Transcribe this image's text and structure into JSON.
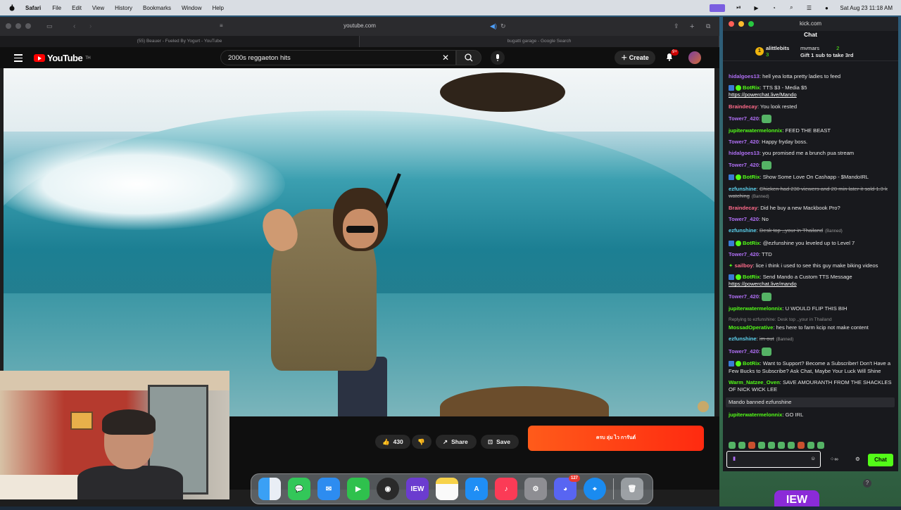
{
  "menubar": {
    "app": "Safari",
    "items": [
      "File",
      "Edit",
      "View",
      "History",
      "Bookmarks",
      "Window",
      "Help"
    ],
    "clock": "Sat Aug 23  11:18 AM"
  },
  "safari": {
    "address": "youtube.com",
    "tabs": [
      "(55) Beauer - Fueled By Yogurt - YouTube",
      "bugatti garage - Google Search"
    ]
  },
  "youtube": {
    "logo": "YouTube",
    "logo_sup": "TH",
    "search_value": "2000s reggaeton hits",
    "create_label": "Create",
    "notif_badge": "9+",
    "likes": "430",
    "share_label": "Share",
    "save_label": "Save",
    "ad_text": "ครบ ลุ่ม ไว การันต์"
  },
  "dock": {
    "icons": [
      "finder",
      "messages",
      "mail",
      "facetime",
      "obs",
      "iew",
      "notes",
      "app-store",
      "music",
      "system-settings",
      "discord",
      "safari",
      "trash"
    ],
    "discord_badge": "127",
    "iew_label": "IEW"
  },
  "kick": {
    "window_title": "kick.com",
    "chat_title": "Chat",
    "gifter1_name": "alittlebits",
    "gifter1_count": "3",
    "gifter1_rank": "1",
    "gifter2_name": "mvmars",
    "gifter2_count": "2",
    "gift_prompt": "Gift 1 sub to take 3rd",
    "messages": [
      {
        "user": "hidalgoes13",
        "color": "#b06ff5",
        "text": "hell yea lotta pretty ladies to feed"
      },
      {
        "user": "BotRix",
        "color": "#53fc18",
        "text": "TTS $3 - Media $5",
        "link": "https://powerchat.live/Mando",
        "bot": true
      },
      {
        "user": "Braindecay",
        "color": "#ff6b8a",
        "text": "You look rested"
      },
      {
        "user": "Tower7_420",
        "color": "#b06ff5",
        "text": "",
        "emote": true
      },
      {
        "user": "jupiterwatermelonnix",
        "color": "#53fc18",
        "text": "FEED THE BEAST"
      },
      {
        "user": "Tower7_420",
        "color": "#b06ff5",
        "text": "Happy fryday boss."
      },
      {
        "user": "hidalgoes13",
        "color": "#b06ff5",
        "text": "you promised me a brunch pua stream"
      },
      {
        "user": "Tower7_420",
        "color": "#b06ff5",
        "text": "",
        "emote": true
      },
      {
        "user": "BotRix",
        "color": "#53fc18",
        "text": "Show Some Love On Cashapp - $MandoIRL",
        "bot": true
      },
      {
        "user": "ezfunshine",
        "color": "#5dd3f0",
        "text": "Chicken had 230 viewers and 20 min later it sold 1.3 k watching",
        "deleted": true,
        "banned": "(Banned)"
      },
      {
        "user": "Braindecay",
        "color": "#ff6b8a",
        "text": "Did he buy a new Mackbook Pro?"
      },
      {
        "user": "Tower7_420",
        "color": "#b06ff5",
        "text": "No"
      },
      {
        "user": "ezfunshine",
        "color": "#5dd3f0",
        "text": "Desk top ,,your in Thailand",
        "deleted": true,
        "banned": "(Banned)"
      },
      {
        "user": "BotRix",
        "color": "#53fc18",
        "text": "@ezfunshine you leveled up to Level 7",
        "bot": true
      },
      {
        "user": "Tower7_420",
        "color": "#b06ff5",
        "text": "TTD"
      },
      {
        "user": "sailboy",
        "color": "#ff6b8a",
        "text": "lice i think i used to see this guy make biking videos",
        "sailboy": true
      },
      {
        "user": "BotRix",
        "color": "#53fc18",
        "text": "Send Mando a Custom TTS Message",
        "link": "https://powerchat.live/mando",
        "bot": true
      },
      {
        "user": "Tower7_420",
        "color": "#b06ff5",
        "text": "",
        "emote": true
      },
      {
        "user": "jupiterwatermelonnix",
        "color": "#53fc18",
        "text": "U WOULD FLIP THIS BIH"
      },
      {
        "reply": "Replying to ezfunshine: Desk top ,,your in Thailand",
        "user": "MossadOperative",
        "color": "#53fc18",
        "text": "hes here to farm kcip not make content"
      },
      {
        "user": "ezfunshine",
        "color": "#5dd3f0",
        "text": "im out",
        "deleted": true,
        "banned": "(Banned)"
      },
      {
        "user": "Tower7_420",
        "color": "#b06ff5",
        "text": "",
        "emote": true
      },
      {
        "user": "BotRix",
        "color": "#53fc18",
        "text": "Want to Support? Become a Subscriber! Don't Have a Few Bucks to Subscribe? Ask Chat, Maybe Your Luck Will Shine",
        "bot": true
      },
      {
        "user": "Warm_Natzee_Oven",
        "color": "#53fc18",
        "text": "SAVE AMOURANTH FROM THE SHACKLES OF NICK WICK LEE"
      },
      {
        "system": "Mando banned ezfunshine"
      },
      {
        "user": "jupiterwatermelonnix",
        "color": "#53fc18",
        "text": "GO IRL"
      }
    ],
    "send_label": "Chat",
    "logo_peek": "IEW"
  },
  "colors": {
    "kick_green": "#53fc18",
    "yt_red": "#ff0000"
  }
}
